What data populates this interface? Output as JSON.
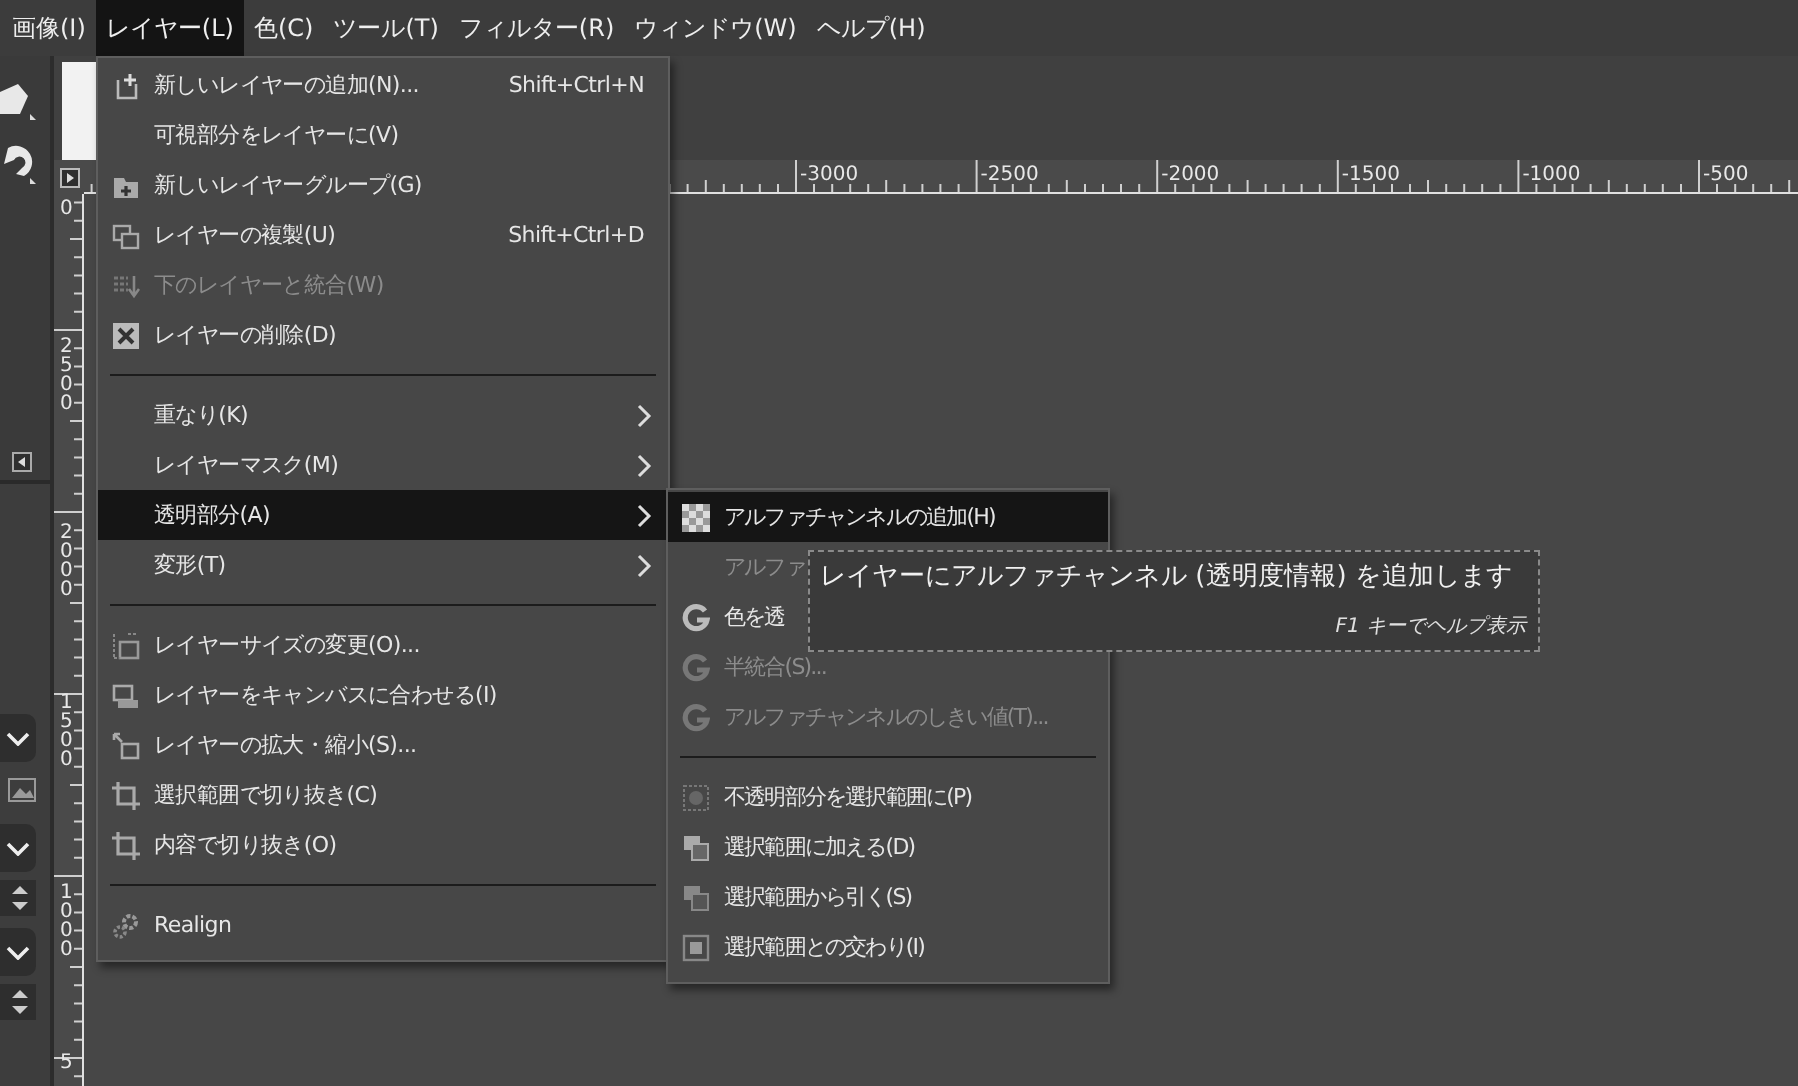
{
  "menubar": [
    {
      "label": "画像(I)",
      "selected": false
    },
    {
      "label": "レイヤー(L)",
      "selected": true
    },
    {
      "label": "色(C)",
      "selected": false
    },
    {
      "label": "ツール(T)",
      "selected": false
    },
    {
      "label": "フィルター(R)",
      "selected": false
    },
    {
      "label": "ウィンドウ(W)",
      "selected": false
    },
    {
      "label": "ヘルプ(H)",
      "selected": false
    }
  ],
  "layer_menu": {
    "items": [
      {
        "kind": "item",
        "label": "新しいレイヤーの追加(N)...",
        "shortcut": "Shift+Ctrl+N",
        "disabled": false,
        "selected": false
      },
      {
        "kind": "item",
        "label": "可視部分をレイヤーに(V)",
        "disabled": false,
        "selected": false
      },
      {
        "kind": "item",
        "label": "新しいレイヤーグループ(G)",
        "disabled": false,
        "selected": false
      },
      {
        "kind": "item",
        "label": "レイヤーの複製(U)",
        "shortcut": "Shift+Ctrl+D",
        "disabled": false,
        "selected": false
      },
      {
        "kind": "item",
        "label": "下のレイヤーと統合(W)",
        "disabled": true,
        "selected": false
      },
      {
        "kind": "item",
        "label": "レイヤーの削除(D)",
        "disabled": false,
        "selected": false
      },
      {
        "kind": "separator"
      },
      {
        "kind": "submenu",
        "label": "重なり(K)",
        "disabled": false,
        "selected": false
      },
      {
        "kind": "submenu",
        "label": "レイヤーマスク(M)",
        "disabled": false,
        "selected": false
      },
      {
        "kind": "submenu",
        "label": "透明部分(A)",
        "disabled": false,
        "selected": true
      },
      {
        "kind": "submenu",
        "label": "変形(T)",
        "disabled": false,
        "selected": false
      },
      {
        "kind": "separator"
      },
      {
        "kind": "item",
        "label": "レイヤーサイズの変更(O)...",
        "disabled": false,
        "selected": false
      },
      {
        "kind": "item",
        "label": "レイヤーをキャンバスに合わせる(I)",
        "disabled": false,
        "selected": false
      },
      {
        "kind": "item",
        "label": "レイヤーの拡大・縮小(S)...",
        "disabled": false,
        "selected": false
      },
      {
        "kind": "item",
        "label": "選択範囲で切り抜き(C)",
        "disabled": false,
        "selected": false
      },
      {
        "kind": "item",
        "label": "内容で切り抜き(O)",
        "disabled": false,
        "selected": false
      },
      {
        "kind": "separator"
      },
      {
        "kind": "item",
        "label": "Realign",
        "disabled": false,
        "selected": false
      }
    ]
  },
  "transparency_submenu": {
    "items": [
      {
        "kind": "item",
        "label": "アルファチャンネルの追加(H)",
        "disabled": false,
        "selected": true
      },
      {
        "kind": "item",
        "label": "アルファ",
        "disabled": true,
        "selected": false
      },
      {
        "kind": "item",
        "label": "色を透",
        "disabled": false,
        "selected": false
      },
      {
        "kind": "item",
        "label": "半統合(S)...",
        "disabled": true,
        "selected": false
      },
      {
        "kind": "item",
        "label": "アルファチャンネルのしきい値(T)...",
        "disabled": true,
        "selected": false
      },
      {
        "kind": "separator"
      },
      {
        "kind": "item",
        "label": "不透明部分を選択範囲に(P)",
        "disabled": false,
        "selected": false
      },
      {
        "kind": "item",
        "label": "選択範囲に加える(D)",
        "disabled": false,
        "selected": false
      },
      {
        "kind": "item",
        "label": "選択範囲から引く(S)",
        "disabled": false,
        "selected": false
      },
      {
        "kind": "item",
        "label": "選択範囲との交わり(I)",
        "disabled": false,
        "selected": false
      }
    ]
  },
  "tooltip": {
    "text": "レイヤーにアルファチャンネル (透明度情報) を追加します",
    "help_hint": "F1 キーでヘルプ表示"
  },
  "horizontal_ruler": {
    "labels": [
      "-3000",
      "-2500",
      "-2000",
      "-1500",
      "-1000",
      "-500"
    ]
  },
  "vertical_ruler": {
    "labels": [
      "0",
      "2500",
      "2000",
      "1500",
      "1000",
      "5"
    ]
  }
}
